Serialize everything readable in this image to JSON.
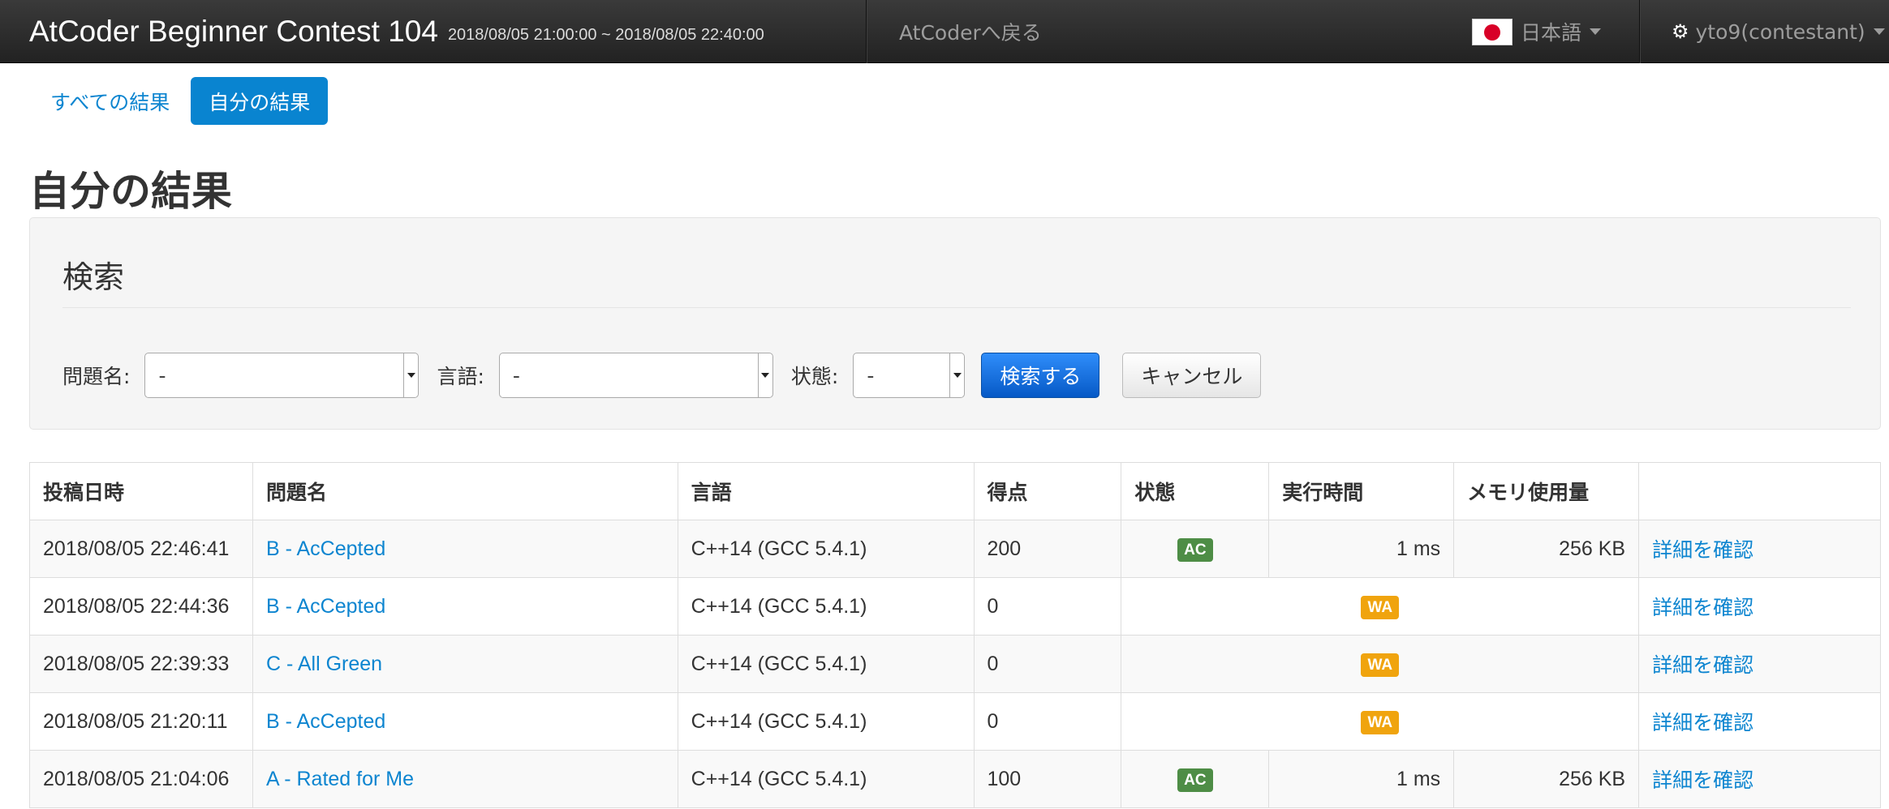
{
  "navbar": {
    "contest_title": "AtCoder Beginner Contest 104",
    "contest_period": "2018/08/05 21:00:00 ~ 2018/08/05 22:40:00",
    "back_link": "AtCoderへ戻る",
    "language": "日本語",
    "user": "yto9(contestant)"
  },
  "tabs": [
    {
      "label": "すべての結果",
      "active": false
    },
    {
      "label": "自分の結果",
      "active": true
    }
  ],
  "page_title": "自分の結果",
  "search": {
    "title": "検索",
    "problem_label": "問題名:",
    "problem_value": "-",
    "language_label": "言語:",
    "language_value": "-",
    "status_label": "状態:",
    "status_value": "-",
    "submit_label": "検索する",
    "cancel_label": "キャンセル"
  },
  "table": {
    "headers": [
      "投稿日時",
      "問題名",
      "言語",
      "得点",
      "状態",
      "実行時間",
      "メモリ使用量",
      ""
    ],
    "rows": [
      {
        "time": "2018/08/05 22:46:41",
        "problem": "B - AcCepted",
        "language": "C++14 (GCC 5.4.1)",
        "score": "200",
        "status": "AC",
        "exec_time": "1 ms",
        "memory": "256 KB",
        "detail": "詳細を確認"
      },
      {
        "time": "2018/08/05 22:44:36",
        "problem": "B - AcCepted",
        "language": "C++14 (GCC 5.4.1)",
        "score": "0",
        "status": "WA",
        "exec_time": "",
        "memory": "",
        "detail": "詳細を確認"
      },
      {
        "time": "2018/08/05 22:39:33",
        "problem": "C - All Green",
        "language": "C++14 (GCC 5.4.1)",
        "score": "0",
        "status": "WA",
        "exec_time": "",
        "memory": "",
        "detail": "詳細を確認"
      },
      {
        "time": "2018/08/05 21:20:11",
        "problem": "B - AcCepted",
        "language": "C++14 (GCC 5.4.1)",
        "score": "0",
        "status": "WA",
        "exec_time": "",
        "memory": "",
        "detail": "詳細を確認"
      },
      {
        "time": "2018/08/05 21:04:06",
        "problem": "A - Rated for Me",
        "language": "C++14 (GCC 5.4.1)",
        "score": "100",
        "status": "AC",
        "exec_time": "1 ms",
        "memory": "256 KB",
        "detail": "詳細を確認"
      }
    ]
  },
  "colors": {
    "navbar_bg": "#222222",
    "accent_blue": "#0984d0",
    "link_blue": "#0d85d0",
    "ac_green": "#4e8d46",
    "wa_orange": "#f0a40e"
  },
  "icons": {
    "flag": "japan-flag-icon",
    "settings": "gear-icon",
    "dropdown": "caret-down-icon"
  }
}
